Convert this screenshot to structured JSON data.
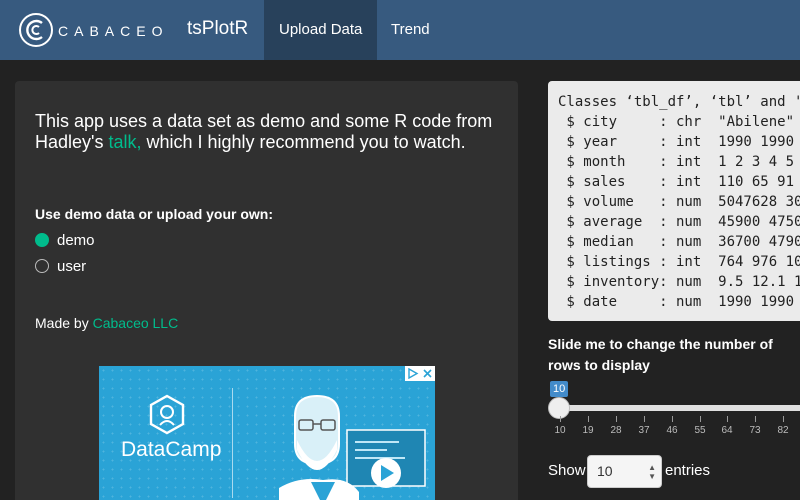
{
  "navbar": {
    "logo_text": "CABACEO",
    "brand": "tsPlotR",
    "tabs": [
      {
        "label": "Upload Data",
        "active": true
      },
      {
        "label": "Trend",
        "active": false
      }
    ]
  },
  "intro": {
    "text_before": "This app uses a data set as demo and some R code from Hadley's ",
    "link_text": "talk,",
    "text_after": " which I highly recommend you to watch."
  },
  "data_source": {
    "label": "Use demo data or upload your own:",
    "options": [
      {
        "label": "demo",
        "selected": true
      },
      {
        "label": "user",
        "selected": false
      }
    ]
  },
  "credit": {
    "prefix": "Made by ",
    "link": "Cabaceo LLC"
  },
  "ad": {
    "brand": "DataCamp",
    "info_icon": "info-triangle-icon",
    "close_icon": "close-icon"
  },
  "str_output": {
    "lines": [
      "Classes ‘tbl_df’, ‘tbl’ and '",
      " $ city     : chr  \"Abilene\" ",
      " $ year     : int  1990 1990 ",
      " $ month    : int  1 2 3 4 5 ",
      " $ sales    : int  110 65 91 ",
      " $ volume   : num  5047628 30",
      " $ average  : num  45900 4750",
      " $ median   : num  36700 4790",
      " $ listings : int  764 976 10",
      " $ inventory: num  9.5 12.1 1",
      " $ date     : num  1990 1990 "
    ]
  },
  "slider": {
    "label": "Slide me to change the number of rows to display",
    "value": 10,
    "min": 10,
    "ticks": [
      "10",
      "19",
      "28",
      "37",
      "46",
      "55",
      "64",
      "73",
      "82"
    ]
  },
  "table_length": {
    "show_label": "Show",
    "selected": "10",
    "entries_label": "entries"
  },
  "colors": {
    "navbar": "#375a7f",
    "accent": "#00bc8c",
    "background": "#222222",
    "panel": "#303030"
  }
}
